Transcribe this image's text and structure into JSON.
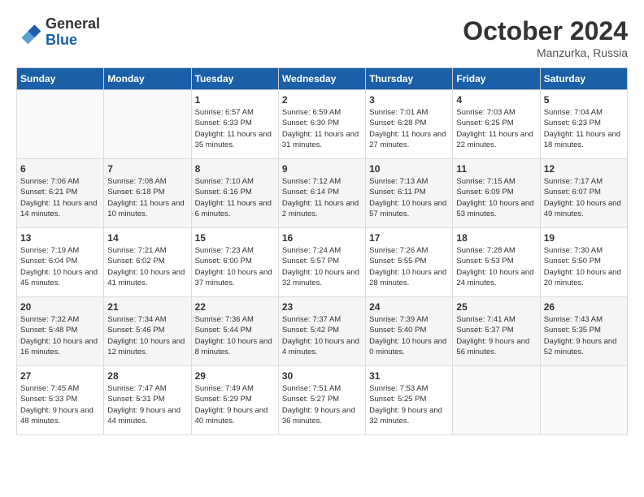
{
  "header": {
    "logo_general": "General",
    "logo_blue": "Blue",
    "month_year": "October 2024",
    "location": "Manzurka, Russia"
  },
  "weekdays": [
    "Sunday",
    "Monday",
    "Tuesday",
    "Wednesday",
    "Thursday",
    "Friday",
    "Saturday"
  ],
  "weeks": [
    [
      {
        "day": null
      },
      {
        "day": null
      },
      {
        "day": "1",
        "sunrise": "Sunrise: 6:57 AM",
        "sunset": "Sunset: 6:33 PM",
        "daylight": "Daylight: 11 hours and 35 minutes."
      },
      {
        "day": "2",
        "sunrise": "Sunrise: 6:59 AM",
        "sunset": "Sunset: 6:30 PM",
        "daylight": "Daylight: 11 hours and 31 minutes."
      },
      {
        "day": "3",
        "sunrise": "Sunrise: 7:01 AM",
        "sunset": "Sunset: 6:28 PM",
        "daylight": "Daylight: 11 hours and 27 minutes."
      },
      {
        "day": "4",
        "sunrise": "Sunrise: 7:03 AM",
        "sunset": "Sunset: 6:25 PM",
        "daylight": "Daylight: 11 hours and 22 minutes."
      },
      {
        "day": "5",
        "sunrise": "Sunrise: 7:04 AM",
        "sunset": "Sunset: 6:23 PM",
        "daylight": "Daylight: 11 hours and 18 minutes."
      }
    ],
    [
      {
        "day": "6",
        "sunrise": "Sunrise: 7:06 AM",
        "sunset": "Sunset: 6:21 PM",
        "daylight": "Daylight: 11 hours and 14 minutes."
      },
      {
        "day": "7",
        "sunrise": "Sunrise: 7:08 AM",
        "sunset": "Sunset: 6:18 PM",
        "daylight": "Daylight: 11 hours and 10 minutes."
      },
      {
        "day": "8",
        "sunrise": "Sunrise: 7:10 AM",
        "sunset": "Sunset: 6:16 PM",
        "daylight": "Daylight: 11 hours and 6 minutes."
      },
      {
        "day": "9",
        "sunrise": "Sunrise: 7:12 AM",
        "sunset": "Sunset: 6:14 PM",
        "daylight": "Daylight: 11 hours and 2 minutes."
      },
      {
        "day": "10",
        "sunrise": "Sunrise: 7:13 AM",
        "sunset": "Sunset: 6:11 PM",
        "daylight": "Daylight: 10 hours and 57 minutes."
      },
      {
        "day": "11",
        "sunrise": "Sunrise: 7:15 AM",
        "sunset": "Sunset: 6:09 PM",
        "daylight": "Daylight: 10 hours and 53 minutes."
      },
      {
        "day": "12",
        "sunrise": "Sunrise: 7:17 AM",
        "sunset": "Sunset: 6:07 PM",
        "daylight": "Daylight: 10 hours and 49 minutes."
      }
    ],
    [
      {
        "day": "13",
        "sunrise": "Sunrise: 7:19 AM",
        "sunset": "Sunset: 6:04 PM",
        "daylight": "Daylight: 10 hours and 45 minutes."
      },
      {
        "day": "14",
        "sunrise": "Sunrise: 7:21 AM",
        "sunset": "Sunset: 6:02 PM",
        "daylight": "Daylight: 10 hours and 41 minutes."
      },
      {
        "day": "15",
        "sunrise": "Sunrise: 7:23 AM",
        "sunset": "Sunset: 6:00 PM",
        "daylight": "Daylight: 10 hours and 37 minutes."
      },
      {
        "day": "16",
        "sunrise": "Sunrise: 7:24 AM",
        "sunset": "Sunset: 5:57 PM",
        "daylight": "Daylight: 10 hours and 32 minutes."
      },
      {
        "day": "17",
        "sunrise": "Sunrise: 7:26 AM",
        "sunset": "Sunset: 5:55 PM",
        "daylight": "Daylight: 10 hours and 28 minutes."
      },
      {
        "day": "18",
        "sunrise": "Sunrise: 7:28 AM",
        "sunset": "Sunset: 5:53 PM",
        "daylight": "Daylight: 10 hours and 24 minutes."
      },
      {
        "day": "19",
        "sunrise": "Sunrise: 7:30 AM",
        "sunset": "Sunset: 5:50 PM",
        "daylight": "Daylight: 10 hours and 20 minutes."
      }
    ],
    [
      {
        "day": "20",
        "sunrise": "Sunrise: 7:32 AM",
        "sunset": "Sunset: 5:48 PM",
        "daylight": "Daylight: 10 hours and 16 minutes."
      },
      {
        "day": "21",
        "sunrise": "Sunrise: 7:34 AM",
        "sunset": "Sunset: 5:46 PM",
        "daylight": "Daylight: 10 hours and 12 minutes."
      },
      {
        "day": "22",
        "sunrise": "Sunrise: 7:36 AM",
        "sunset": "Sunset: 5:44 PM",
        "daylight": "Daylight: 10 hours and 8 minutes."
      },
      {
        "day": "23",
        "sunrise": "Sunrise: 7:37 AM",
        "sunset": "Sunset: 5:42 PM",
        "daylight": "Daylight: 10 hours and 4 minutes."
      },
      {
        "day": "24",
        "sunrise": "Sunrise: 7:39 AM",
        "sunset": "Sunset: 5:40 PM",
        "daylight": "Daylight: 10 hours and 0 minutes."
      },
      {
        "day": "25",
        "sunrise": "Sunrise: 7:41 AM",
        "sunset": "Sunset: 5:37 PM",
        "daylight": "Daylight: 9 hours and 56 minutes."
      },
      {
        "day": "26",
        "sunrise": "Sunrise: 7:43 AM",
        "sunset": "Sunset: 5:35 PM",
        "daylight": "Daylight: 9 hours and 52 minutes."
      }
    ],
    [
      {
        "day": "27",
        "sunrise": "Sunrise: 7:45 AM",
        "sunset": "Sunset: 5:33 PM",
        "daylight": "Daylight: 9 hours and 48 minutes."
      },
      {
        "day": "28",
        "sunrise": "Sunrise: 7:47 AM",
        "sunset": "Sunset: 5:31 PM",
        "daylight": "Daylight: 9 hours and 44 minutes."
      },
      {
        "day": "29",
        "sunrise": "Sunrise: 7:49 AM",
        "sunset": "Sunset: 5:29 PM",
        "daylight": "Daylight: 9 hours and 40 minutes."
      },
      {
        "day": "30",
        "sunrise": "Sunrise: 7:51 AM",
        "sunset": "Sunset: 5:27 PM",
        "daylight": "Daylight: 9 hours and 36 minutes."
      },
      {
        "day": "31",
        "sunrise": "Sunrise: 7:53 AM",
        "sunset": "Sunset: 5:25 PM",
        "daylight": "Daylight: 9 hours and 32 minutes."
      },
      {
        "day": null
      },
      {
        "day": null
      }
    ]
  ]
}
